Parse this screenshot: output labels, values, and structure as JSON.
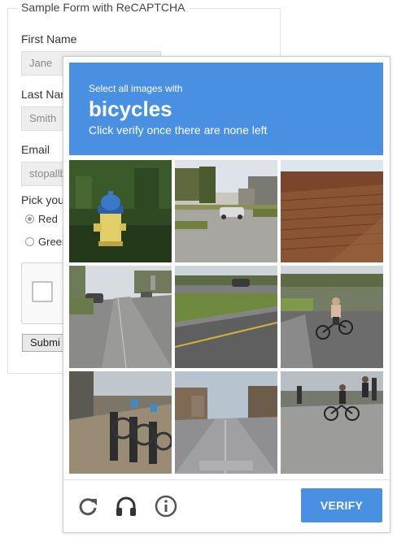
{
  "form": {
    "legend": "Sample Form with ReCAPTCHA",
    "first_name_label": "First Name",
    "first_name_value": "Jane",
    "last_name_label": "Last Nar",
    "last_name_value": "Smith",
    "email_label": "Email",
    "email_value": "stopallb",
    "pick_label": "Pick you",
    "radio_options": [
      "Red",
      "Green"
    ],
    "radio_selected": "Red",
    "submit_label": "Submi"
  },
  "challenge": {
    "instruction": "Select all images with",
    "keyword": "bicycles",
    "subtext": "Click verify once there are none left",
    "tiles": [
      {
        "scene": "fire hydrant",
        "selected": false
      },
      {
        "scene": "street with parked car",
        "selected": false
      },
      {
        "scene": "roof",
        "selected": false
      },
      {
        "scene": "road with cars",
        "selected": false
      },
      {
        "scene": "road with car",
        "selected": false
      },
      {
        "scene": "cyclist on road",
        "selected": false
      },
      {
        "scene": "bike share rack",
        "selected": false
      },
      {
        "scene": "city street",
        "selected": false
      },
      {
        "scene": "people with bicycle",
        "selected": false
      }
    ],
    "footer": {
      "reload_icon": "reload-icon",
      "audio_icon": "headphones-icon",
      "info_icon": "info-icon",
      "verify_label": "VERIFY"
    }
  },
  "colors": {
    "accent": "#4a90e2",
    "header_text": "#ffffff"
  }
}
